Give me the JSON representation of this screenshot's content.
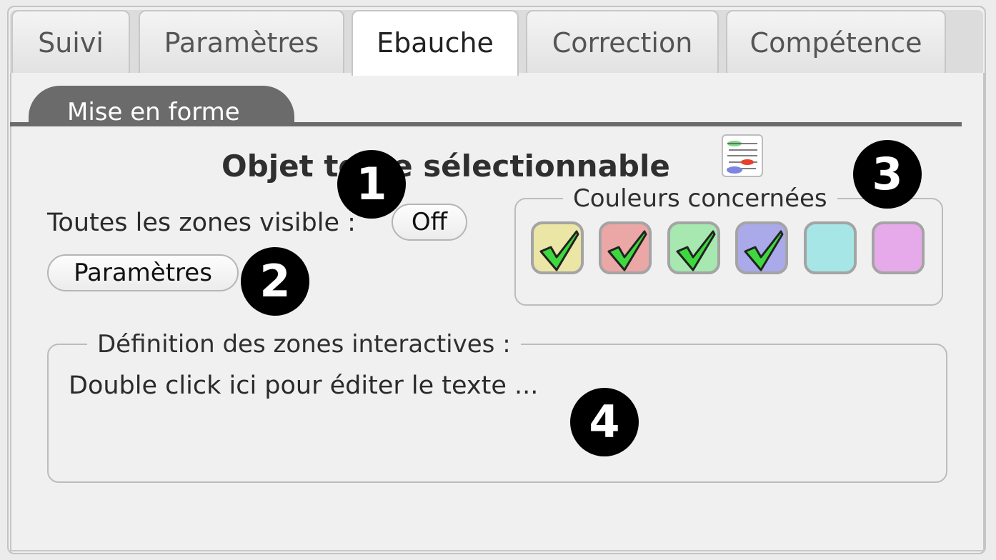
{
  "tabs": [
    {
      "label": "Suivi",
      "active": false
    },
    {
      "label": "Paramètres",
      "active": false
    },
    {
      "label": "Ebauche",
      "active": true
    },
    {
      "label": "Correction",
      "active": false
    },
    {
      "label": "Compétence",
      "active": false
    }
  ],
  "subtab": {
    "label": "Mise en forme"
  },
  "object": {
    "title": "Objet texte sélectionnable"
  },
  "visibility": {
    "label": "Toutes les zones visible :",
    "toggle_value": "Off"
  },
  "params_button": {
    "label": "Paramètres"
  },
  "colors": {
    "legend": "Couleurs concernées",
    "swatches": [
      {
        "name": "yellow",
        "color": "#ebe6a6",
        "checked": true
      },
      {
        "name": "red",
        "color": "#eba6a6",
        "checked": true
      },
      {
        "name": "green",
        "color": "#a6e8b0",
        "checked": true
      },
      {
        "name": "blue",
        "color": "#aaaaea",
        "checked": true
      },
      {
        "name": "cyan",
        "color": "#a6e6e6",
        "checked": false
      },
      {
        "name": "pink",
        "color": "#e6aaea",
        "checked": false
      }
    ]
  },
  "zones": {
    "legend": "Définition des zones interactives :",
    "text": "Double click ici pour éditer le texte ..."
  },
  "badges": {
    "b1": "1",
    "b2": "2",
    "b3": "3",
    "b4": "4"
  }
}
